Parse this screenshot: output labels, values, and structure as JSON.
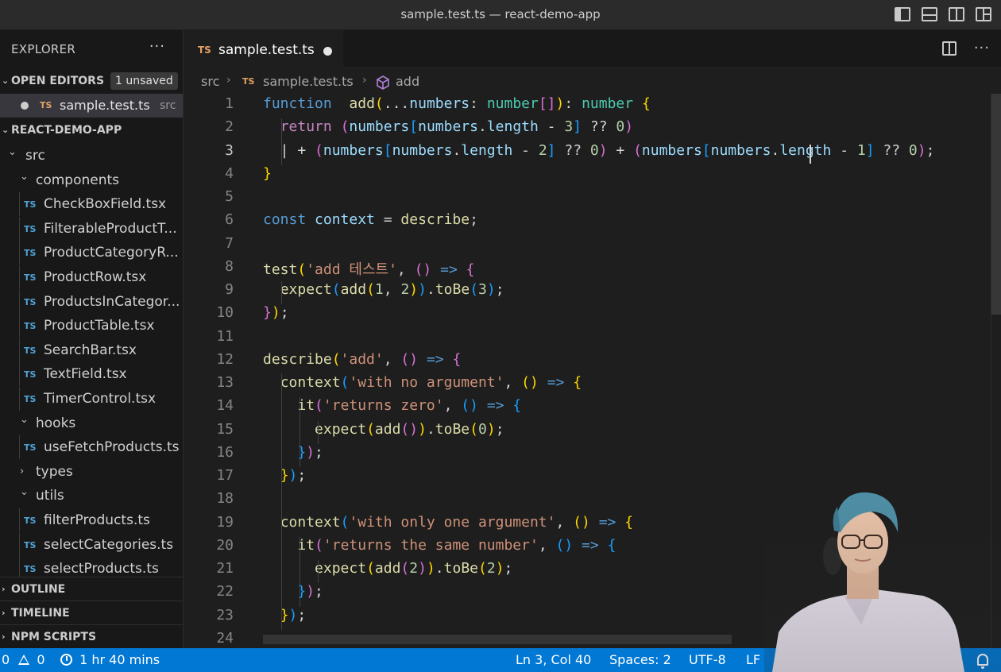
{
  "window": {
    "title": "sample.test.ts — react-demo-app"
  },
  "sidebar": {
    "header": "EXPLORER",
    "more": "···",
    "open_editors": {
      "title": "OPEN EDITORS",
      "badge": "1 unsaved"
    },
    "open_file": {
      "type": "TS",
      "name": "sample.test.ts",
      "dir": "src"
    },
    "project_title": "REACT-DEMO-APP",
    "tree": [
      {
        "kind": "folder",
        "label": "src"
      },
      {
        "kind": "folder",
        "label": "components"
      },
      {
        "kind": "file",
        "type": "TS",
        "label": "CheckBoxField.tsx"
      },
      {
        "kind": "file",
        "type": "TS",
        "label": "FilterableProductT..."
      },
      {
        "kind": "file",
        "type": "TS",
        "label": "ProductCategoryR..."
      },
      {
        "kind": "file",
        "type": "TS",
        "label": "ProductRow.tsx"
      },
      {
        "kind": "file",
        "type": "TS",
        "label": "ProductsInCategor..."
      },
      {
        "kind": "file",
        "type": "TS",
        "label": "ProductTable.tsx"
      },
      {
        "kind": "file",
        "type": "TS",
        "label": "SearchBar.tsx"
      },
      {
        "kind": "file",
        "type": "TS",
        "label": "TextField.tsx"
      },
      {
        "kind": "file",
        "type": "TS",
        "label": "TimerControl.tsx"
      },
      {
        "kind": "folder",
        "label": "hooks"
      },
      {
        "kind": "file",
        "type": "TS",
        "label": "useFetchProducts.ts"
      },
      {
        "kind": "folder",
        "label": "types"
      },
      {
        "kind": "folder",
        "label": "utils"
      },
      {
        "kind": "file",
        "type": "TS",
        "label": "filterProducts.ts"
      },
      {
        "kind": "file",
        "type": "TS",
        "label": "selectCategories.ts"
      },
      {
        "kind": "file",
        "type": "TS",
        "label": "selectProducts.ts"
      }
    ],
    "bottom_sections": [
      "OUTLINE",
      "TIMELINE",
      "NPM SCRIPTS"
    ]
  },
  "editor": {
    "tab": {
      "type": "TS",
      "name": "sample.test.ts"
    },
    "breadcrumb": {
      "folder": "src",
      "type": "TS",
      "file": "sample.test.ts",
      "symbol": "add"
    },
    "active_line": 3,
    "line_numbers": [
      "1",
      "2",
      "3",
      "4",
      "5",
      "6",
      "7",
      "8",
      "9",
      "10",
      "11",
      "12",
      "13",
      "14",
      "15",
      "16",
      "17",
      "18",
      "19",
      "20",
      "21",
      "22",
      "23",
      "24"
    ],
    "code": [
      [
        [
          "kw",
          "function"
        ],
        [
          "",
          "  "
        ],
        [
          "fn",
          "add"
        ],
        [
          "b1",
          "("
        ],
        [
          "",
          "..."
        ],
        [
          "va",
          "numbers"
        ],
        [
          "",
          ": "
        ],
        [
          "ty",
          "number"
        ],
        [
          "b2",
          "[]"
        ],
        [
          "b1",
          ")"
        ],
        [
          "",
          ": "
        ],
        [
          "ty",
          "number"
        ],
        [
          "",
          " "
        ],
        [
          "b1",
          "{"
        ]
      ],
      [
        [
          "",
          "  "
        ],
        [
          "ctl",
          "return"
        ],
        [
          "",
          " "
        ],
        [
          "b2",
          "("
        ],
        [
          "va",
          "numbers"
        ],
        [
          "b3",
          "["
        ],
        [
          "va",
          "numbers"
        ],
        [
          "",
          "."
        ],
        [
          "va",
          "length"
        ],
        [
          "",
          " - "
        ],
        [
          "nu",
          "3"
        ],
        [
          "b3",
          "]"
        ],
        [
          "",
          " ?? "
        ],
        [
          "nu",
          "0"
        ],
        [
          "b2",
          ")"
        ]
      ],
      [
        [
          "",
          "  | + "
        ],
        [
          "b2",
          "("
        ],
        [
          "va",
          "numbers"
        ],
        [
          "b3",
          "["
        ],
        [
          "va",
          "numbers"
        ],
        [
          "",
          "."
        ],
        [
          "va",
          "length"
        ],
        [
          "",
          " - "
        ],
        [
          "nu",
          "2"
        ],
        [
          "b3",
          "]"
        ],
        [
          "",
          " ?? "
        ],
        [
          "nu",
          "0"
        ],
        [
          "b2",
          ")"
        ],
        [
          "",
          " + "
        ],
        [
          "b2",
          "("
        ],
        [
          "va",
          "numbers"
        ],
        [
          "b3",
          "["
        ],
        [
          "va",
          "numbers"
        ],
        [
          "",
          "."
        ],
        [
          "va",
          "length"
        ],
        [
          "",
          " - "
        ],
        [
          "nu",
          "1"
        ],
        [
          "b3",
          "]"
        ],
        [
          "",
          " ?? "
        ],
        [
          "nu",
          "0"
        ],
        [
          "b2",
          ")"
        ],
        [
          "",
          ";"
        ]
      ],
      [
        [
          "b1",
          "}"
        ]
      ],
      [],
      [
        [
          "kw",
          "const"
        ],
        [
          "",
          " "
        ],
        [
          "va",
          "context"
        ],
        [
          "",
          " = "
        ],
        [
          "fn",
          "describe"
        ],
        [
          "",
          ";"
        ]
      ],
      [],
      [
        [
          "fn",
          "test"
        ],
        [
          "b1",
          "("
        ],
        [
          "st",
          "'add 테스트'"
        ],
        [
          "",
          ", "
        ],
        [
          "b2",
          "()"
        ],
        [
          "",
          " "
        ],
        [
          "kw",
          "=>"
        ],
        [
          "",
          " "
        ],
        [
          "b2",
          "{"
        ]
      ],
      [
        [
          "",
          "  "
        ],
        [
          "fn",
          "expect"
        ],
        [
          "b3",
          "("
        ],
        [
          "fn",
          "add"
        ],
        [
          "b1",
          "("
        ],
        [
          "nu",
          "1"
        ],
        [
          "",
          ", "
        ],
        [
          "nu",
          "2"
        ],
        [
          "b1",
          ")"
        ],
        [
          "b3",
          ")"
        ],
        [
          "",
          "."
        ],
        [
          "fn",
          "toBe"
        ],
        [
          "b3",
          "("
        ],
        [
          "nu",
          "3"
        ],
        [
          "b3",
          ")"
        ],
        [
          "",
          ";"
        ]
      ],
      [
        [
          "b2",
          "}"
        ],
        [
          "b1",
          ")"
        ],
        [
          "",
          ";"
        ]
      ],
      [],
      [
        [
          "fn",
          "describe"
        ],
        [
          "b1",
          "("
        ],
        [
          "st",
          "'add'"
        ],
        [
          "",
          ", "
        ],
        [
          "b2",
          "()"
        ],
        [
          "",
          " "
        ],
        [
          "kw",
          "=>"
        ],
        [
          "",
          " "
        ],
        [
          "b2",
          "{"
        ]
      ],
      [
        [
          "",
          "  "
        ],
        [
          "fn",
          "context"
        ],
        [
          "b3",
          "("
        ],
        [
          "st",
          "'with no argument'"
        ],
        [
          "",
          ", "
        ],
        [
          "b1",
          "()"
        ],
        [
          "",
          " "
        ],
        [
          "kw",
          "=>"
        ],
        [
          "",
          " "
        ],
        [
          "b1",
          "{"
        ]
      ],
      [
        [
          "",
          "    "
        ],
        [
          "fn",
          "it"
        ],
        [
          "b2",
          "("
        ],
        [
          "st",
          "'returns zero'"
        ],
        [
          "",
          ", "
        ],
        [
          "b3",
          "()"
        ],
        [
          "",
          " "
        ],
        [
          "kw",
          "=>"
        ],
        [
          "",
          " "
        ],
        [
          "b3",
          "{"
        ]
      ],
      [
        [
          "",
          "      "
        ],
        [
          "fn",
          "expect"
        ],
        [
          "b1",
          "("
        ],
        [
          "fn",
          "add"
        ],
        [
          "b2",
          "()"
        ],
        [
          "b1",
          ")"
        ],
        [
          "",
          "."
        ],
        [
          "fn",
          "toBe"
        ],
        [
          "b1",
          "("
        ],
        [
          "nu",
          "0"
        ],
        [
          "b1",
          ")"
        ],
        [
          "",
          ";"
        ]
      ],
      [
        [
          "",
          "    "
        ],
        [
          "b3",
          "}"
        ],
        [
          "b2",
          ")"
        ],
        [
          "",
          ";"
        ]
      ],
      [
        [
          "",
          "  "
        ],
        [
          "b1",
          "}"
        ],
        [
          "b3",
          ")"
        ],
        [
          "",
          ";"
        ]
      ],
      [],
      [
        [
          "",
          "  "
        ],
        [
          "fn",
          "context"
        ],
        [
          "b3",
          "("
        ],
        [
          "st",
          "'with only one argument'"
        ],
        [
          "",
          ", "
        ],
        [
          "b1",
          "()"
        ],
        [
          "",
          " "
        ],
        [
          "kw",
          "=>"
        ],
        [
          "",
          " "
        ],
        [
          "b1",
          "{"
        ]
      ],
      [
        [
          "",
          "    "
        ],
        [
          "fn",
          "it"
        ],
        [
          "b2",
          "("
        ],
        [
          "st",
          "'returns the same number'"
        ],
        [
          "",
          ", "
        ],
        [
          "b3",
          "()"
        ],
        [
          "",
          " "
        ],
        [
          "kw",
          "=>"
        ],
        [
          "",
          " "
        ],
        [
          "b3",
          "{"
        ]
      ],
      [
        [
          "",
          "      "
        ],
        [
          "fn",
          "expect"
        ],
        [
          "b1",
          "("
        ],
        [
          "fn",
          "add"
        ],
        [
          "b2",
          "("
        ],
        [
          "nu",
          "2"
        ],
        [
          "b2",
          ")"
        ],
        [
          "b1",
          ")"
        ],
        [
          "",
          "."
        ],
        [
          "fn",
          "toBe"
        ],
        [
          "b1",
          "("
        ],
        [
          "nu",
          "2"
        ],
        [
          "b1",
          ")"
        ],
        [
          "",
          ";"
        ]
      ],
      [
        [
          "",
          "    "
        ],
        [
          "b3",
          "}"
        ],
        [
          "b2",
          ")"
        ],
        [
          "",
          ";"
        ]
      ],
      [
        [
          "",
          "  "
        ],
        [
          "b1",
          "}"
        ],
        [
          "b3",
          ")"
        ],
        [
          "",
          ";"
        ]
      ],
      []
    ]
  },
  "statusbar": {
    "errors": "0",
    "warnings": "0",
    "timer": "1 hr 40 mins",
    "position": "Ln 3, Col 40",
    "spaces": "Spaces: 2",
    "encoding": "UTF-8",
    "eol": "LF"
  },
  "colors": {
    "accent": "#0078d4",
    "keyword": "#569cd6",
    "function": "#dcdcaa",
    "variable": "#9cdcfe",
    "type": "#4ec9b0",
    "number": "#b5cea8",
    "string": "#ce9178"
  }
}
